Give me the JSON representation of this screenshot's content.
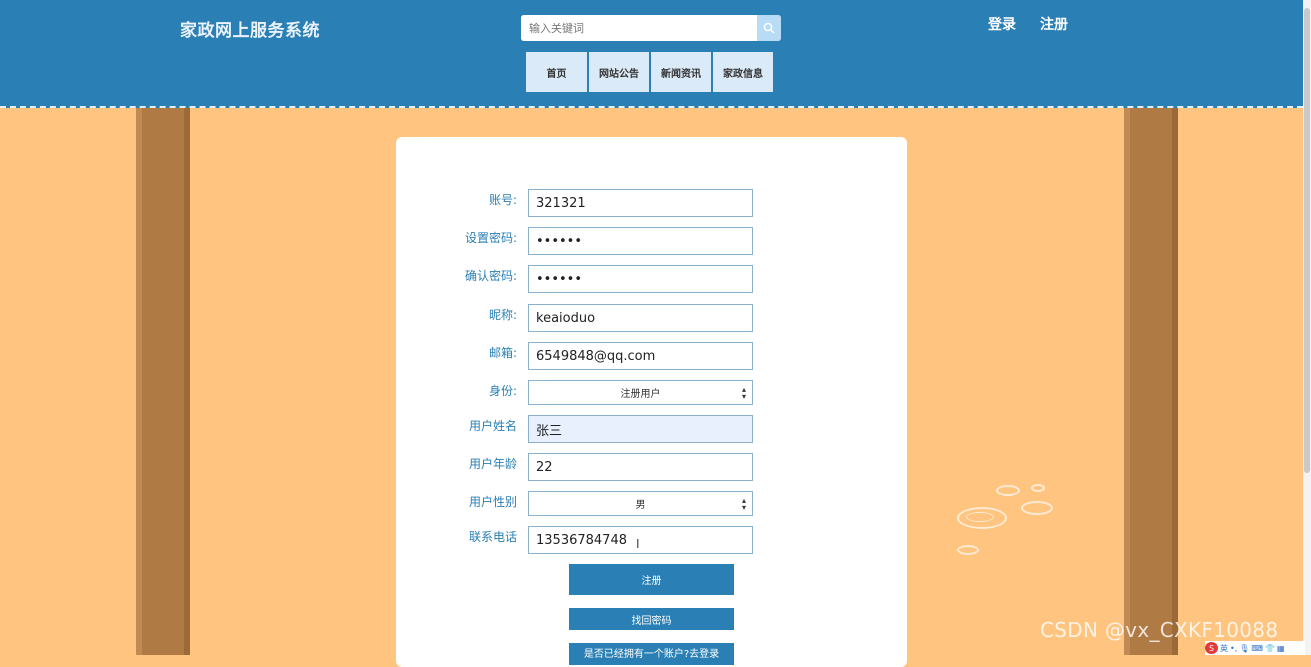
{
  "header": {
    "site_title": "家政网上服务系统",
    "search": {
      "placeholder": "输入关键词"
    },
    "login_label": "登录",
    "register_label": "注册",
    "nav": [
      "首页",
      "网站公告",
      "新闻资讯",
      "家政信息"
    ]
  },
  "form": {
    "account": {
      "label": "账号:",
      "value": "321321"
    },
    "password": {
      "label": "设置密码:",
      "value": "••••••"
    },
    "confirm_password": {
      "label": "确认密码:",
      "value": "••••••"
    },
    "nickname": {
      "label": "昵称:",
      "value": "keaioduo"
    },
    "email": {
      "label": "邮箱:",
      "value": "6549848@qq.com"
    },
    "identity": {
      "label": "身份:",
      "value": "注册用户"
    },
    "real_name": {
      "label": "用户姓名",
      "value": "张三"
    },
    "age": {
      "label": "用户年龄",
      "value": "22"
    },
    "gender": {
      "label": "用户性别",
      "value": "男"
    },
    "phone": {
      "label": "联系电话",
      "value": "13536784748"
    },
    "register_button": "注册",
    "forgot_password_button": "找回密码",
    "have_account_button": "是否已经拥有一个账户?去登录"
  },
  "watermark": "CSDN @vx_CXKF10088",
  "tray": {
    "ime": "S",
    "lang": "英"
  },
  "colors": {
    "header": "#2a7fb4",
    "background": "#ffc47f",
    "pillar": "#b07a44",
    "button": "#2a7fb4"
  }
}
